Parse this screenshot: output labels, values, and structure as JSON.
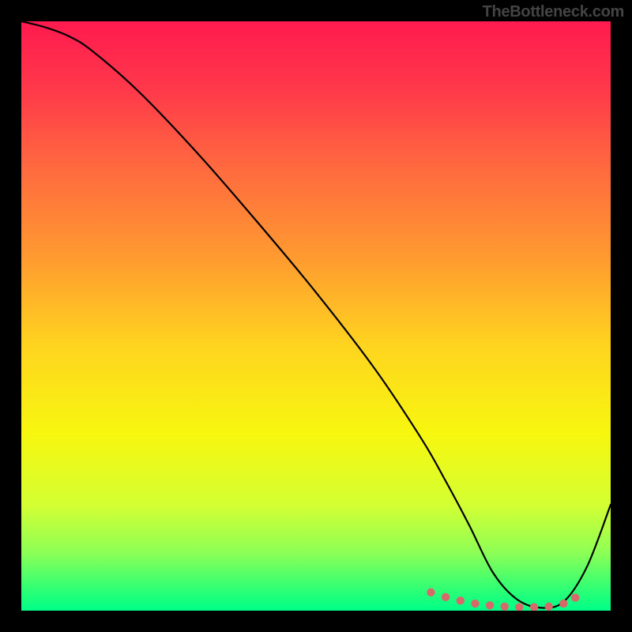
{
  "watermark": "TheBottleneck.com",
  "gradient": {
    "stops": [
      {
        "offset": 0.0,
        "color": "#ff1a4f"
      },
      {
        "offset": 0.12,
        "color": "#ff3a4a"
      },
      {
        "offset": 0.25,
        "color": "#ff6a3f"
      },
      {
        "offset": 0.4,
        "color": "#ff9a30"
      },
      {
        "offset": 0.55,
        "color": "#ffd41f"
      },
      {
        "offset": 0.7,
        "color": "#f7f70f"
      },
      {
        "offset": 0.82,
        "color": "#d4ff32"
      },
      {
        "offset": 0.9,
        "color": "#8fff55"
      },
      {
        "offset": 0.97,
        "color": "#26ff78"
      },
      {
        "offset": 1.0,
        "color": "#00ff88"
      }
    ]
  },
  "chart_data": {
    "type": "line",
    "title": "",
    "xlabel": "",
    "ylabel": "",
    "xlim": [
      0,
      100
    ],
    "ylim": [
      0,
      100
    ],
    "series": [
      {
        "name": "bottleneck-curve",
        "x": [
          0,
          4,
          8,
          12,
          20,
          30,
          40,
          50,
          60,
          68,
          72,
          76,
          80,
          84,
          88,
          92,
          96,
          100
        ],
        "values": [
          100,
          99,
          97.5,
          95,
          88,
          77.5,
          66,
          54,
          41,
          29,
          22,
          14.5,
          6.5,
          2,
          0.5,
          1.5,
          7.5,
          18
        ]
      }
    ],
    "markers": {
      "name": "highlight-dots",
      "color": "#d66a6a",
      "x": [
        69.5,
        72,
        74.5,
        77,
        79.5,
        82,
        84.5,
        87,
        89.5,
        92,
        94
      ],
      "values": [
        3.1,
        2.3,
        1.7,
        1.2,
        0.9,
        0.7,
        0.6,
        0.6,
        0.7,
        1.2,
        2.2
      ]
    }
  }
}
